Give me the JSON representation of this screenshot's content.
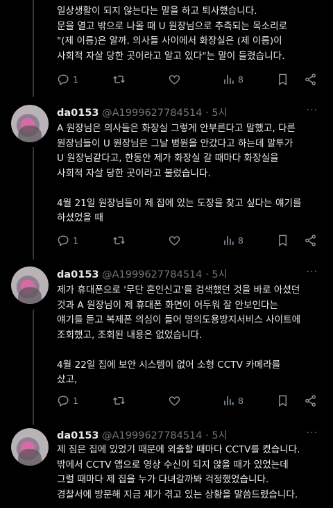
{
  "tweets": [
    {
      "lines": [
        "일상생활이 되지 않는다는 말을 하고 퇴사했습니다.",
        "문을 열고 밖으로 나올 때 U 원장님으로 추측되는 목소리로",
        "\"(제 이름)은 알까. 의사들 사이에서 화장실은 (제 이름)이",
        "사회적 자살 당한 곳이라고 알고 있다\"는 말이 들렸습니다."
      ],
      "actions": {
        "reply": "1",
        "views": "8"
      }
    },
    {
      "username": "da0153",
      "handle": "@A1999627784514",
      "time": "· 5시",
      "more": "···",
      "lines": [
        "A 원장님은 의사들은 화장실 그렇게 안부른다고 말했고, 다른",
        "원장님들이 U 원장님은 그날 병원을 안갔다고 하는데 말투가",
        "U 원장님같다고, 한동안 제가 화장실 갈 때마다 화장실을",
        "사회적 자살 당한 곳이라고 불렀습니다.",
        "",
        "4월 21일 원장님들이 제 집에 있는 도장을 찾고 싶다는 얘기를",
        "하셨었을 때"
      ],
      "actions": {
        "reply": "1",
        "views": "8"
      }
    },
    {
      "username": "da0153",
      "handle": "@A1999627784514",
      "time": "· 5시",
      "more": "···",
      "lines": [
        "제가 휴대폰으로 '무단 혼인신고'를 검색했던 것을 바로 아셨던",
        "것과 A 원장님이 제 휴대폰 화면이 어두워 잘 안보인다는",
        "얘기를 듣고 복제폰 의심이 들어 명의도용방지서비스 사이트에",
        "조회했고, 조회된 내용은 없었습니다.",
        "",
        "4월 22일 집에 보안 시스템이 없어 소형 CCTV 카메라를",
        "샀고,"
      ],
      "actions": {
        "reply": "1",
        "views": "8"
      }
    },
    {
      "username": "da0153",
      "handle": "@A1999627784514",
      "time": "· 5시",
      "more": "···",
      "lines": [
        "제 짐은 집에 있었기 때문에 외출할 때마다 CCTV를 켰습니다.",
        "밖에서 CCTV 앱으로 영상 수신이 되지 않을 때가 있었는데",
        "그럴 때마다 제 집을 누가 다녀갈까봐 걱정했었습니다.",
        "경찰서에 방문해 지금 제가 겪고 있는 상황을 말씀드렸습니다."
      ]
    }
  ]
}
